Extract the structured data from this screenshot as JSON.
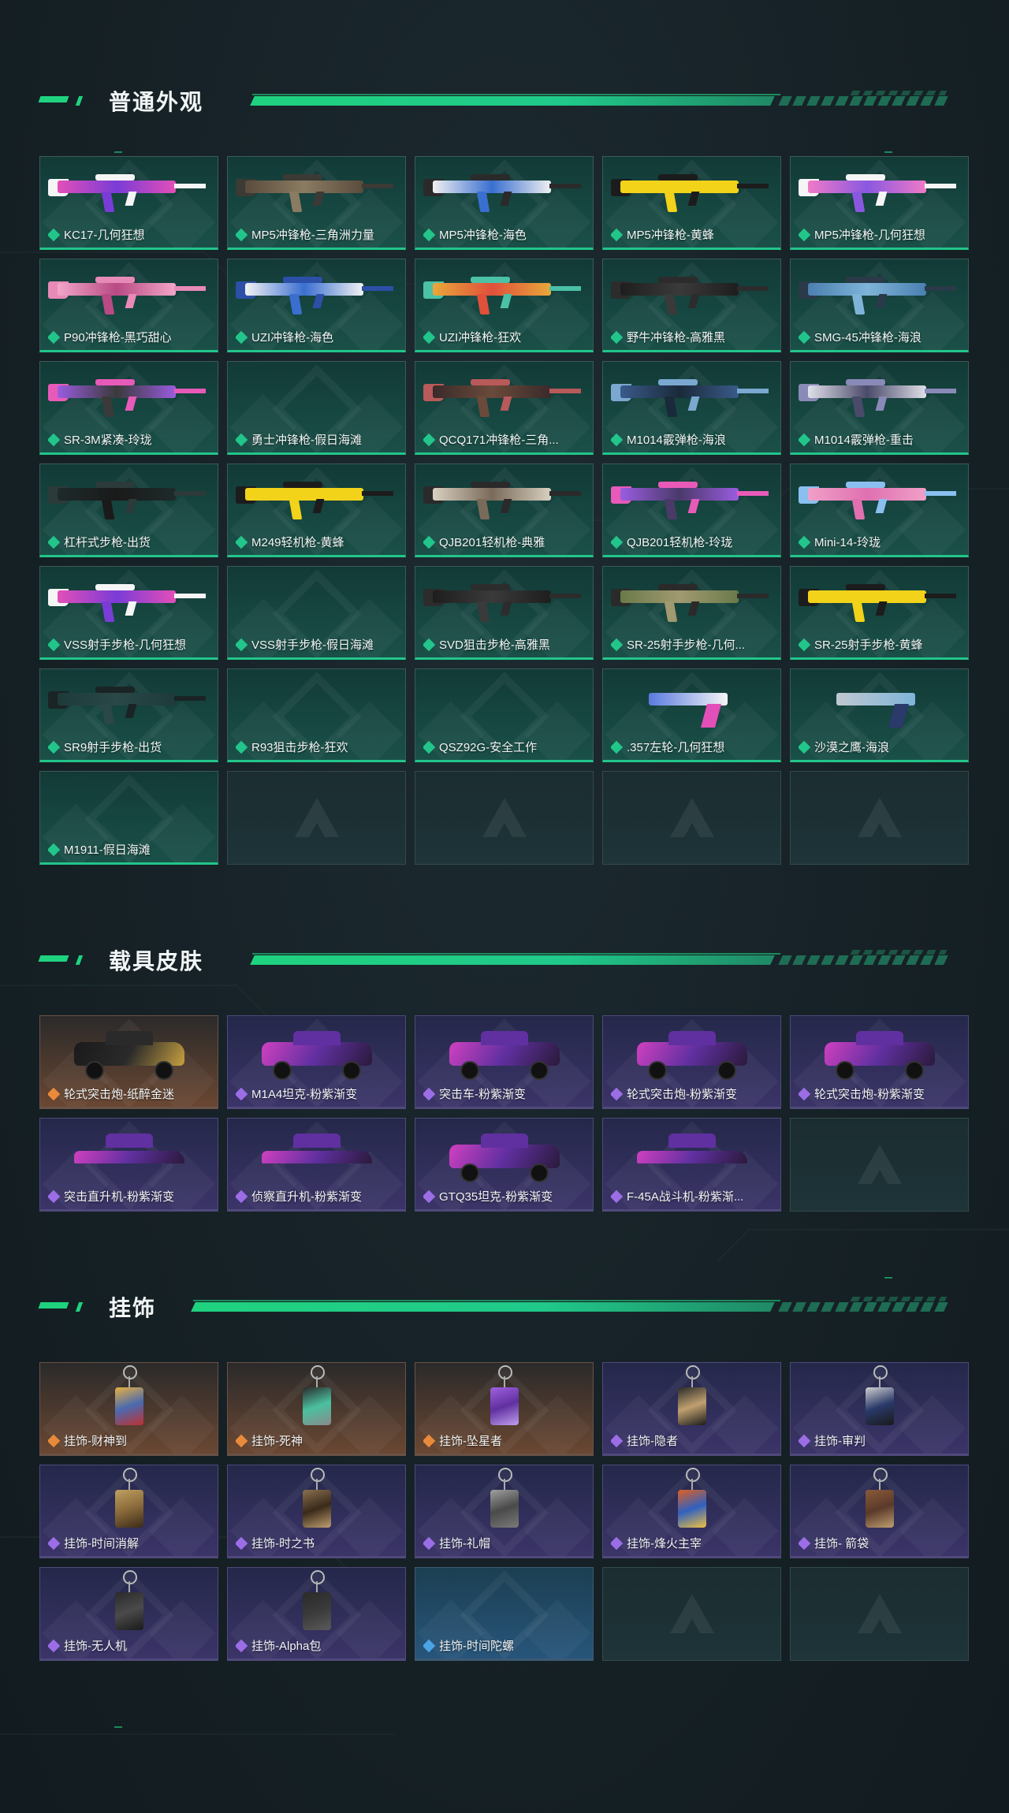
{
  "sections": [
    {
      "id": "weapons",
      "title": "普通外观",
      "items": [
        {
          "name": "KC17-几何狂想",
          "rarity": "green",
          "kind": "gun",
          "colors": [
            "#e34fb8",
            "#f5f5f5",
            "#7a3cd6"
          ]
        },
        {
          "name": "MP5冲锋枪-三角洲力量",
          "rarity": "green",
          "kind": "gun",
          "colors": [
            "#5a4c3c",
            "#3b3a34",
            "#8a7b62"
          ]
        },
        {
          "name": "MP5冲锋枪-海色",
          "rarity": "green",
          "kind": "gun",
          "colors": [
            "#f0f0f0",
            "#2a2a2a",
            "#3a6fd0"
          ]
        },
        {
          "name": "MP5冲锋枪-黄蜂",
          "rarity": "green",
          "kind": "gun",
          "colors": [
            "#f2d31a",
            "#1c1c1c",
            "#f2d31a"
          ]
        },
        {
          "name": "MP5冲锋枪-几何狂想",
          "rarity": "green",
          "kind": "gun",
          "colors": [
            "#f07ac8",
            "#f5f5f5",
            "#8a58e0"
          ]
        },
        {
          "name": "P90冲锋枪-黑巧甜心",
          "rarity": "green",
          "kind": "gun",
          "colors": [
            "#f2a6c8",
            "#e88ab8",
            "#b84a84"
          ]
        },
        {
          "name": "UZI冲锋枪-海色",
          "rarity": "green",
          "kind": "gun",
          "colors": [
            "#f2f2f2",
            "#2c4fa8",
            "#3a6fd0"
          ]
        },
        {
          "name": "UZI冲锋枪-狂欢",
          "rarity": "green",
          "kind": "gun",
          "colors": [
            "#e8a83a",
            "#4bc1a6",
            "#e0503a"
          ]
        },
        {
          "name": "野牛冲锋枪-高雅黑",
          "rarity": "green",
          "kind": "gun",
          "colors": [
            "#1e1e1e",
            "#2c2c2c",
            "#3a3a3a"
          ]
        },
        {
          "name": "SMG-45冲锋枪-海浪",
          "rarity": "green",
          "kind": "gun",
          "colors": [
            "#4a7fb0",
            "#2a3a48",
            "#7fb4d8"
          ]
        },
        {
          "name": "SR-3M紧凑-玲珑",
          "rarity": "green",
          "kind": "gun",
          "colors": [
            "#9a5ce0",
            "#e85ab8",
            "#3a3a3a"
          ]
        },
        {
          "name": "勇士冲锋枪-假日海滩",
          "rarity": "green",
          "kind": "none",
          "colors": []
        },
        {
          "name": "QCQ171冲锋枪-三角...",
          "rarity": "green",
          "kind": "gun",
          "colors": [
            "#3a2a2a",
            "#b85a5a",
            "#6a4a3a"
          ]
        },
        {
          "name": "M1014霰弹枪-海浪",
          "rarity": "green",
          "kind": "gun",
          "colors": [
            "#3a5a8a",
            "#7aa8d0",
            "#1a2a3a"
          ]
        },
        {
          "name": "M1014霰弹枪-重击",
          "rarity": "green",
          "kind": "gun",
          "colors": [
            "#e0e0ea",
            "#8a8ab8",
            "#4a4a6a"
          ]
        },
        {
          "name": "杠杆式步枪-出货",
          "rarity": "green",
          "kind": "gun",
          "colors": [
            "#1e2a2a",
            "#2c3a3a",
            "#1a1a1a"
          ]
        },
        {
          "name": "M249轻机枪-黄蜂",
          "rarity": "green",
          "kind": "gun",
          "colors": [
            "#f2d31a",
            "#1c1c1c",
            "#f2d31a"
          ]
        },
        {
          "name": "QJB201轻机枪-典雅",
          "rarity": "green",
          "kind": "gun",
          "colors": [
            "#d8d0c0",
            "#2a2a2a",
            "#7a6a5a"
          ]
        },
        {
          "name": "QJB201轻机枪-玲珑",
          "rarity": "green",
          "kind": "gun",
          "colors": [
            "#9a5ce0",
            "#e85ab8",
            "#4a3a6a"
          ]
        },
        {
          "name": "Mini-14-玲珑",
          "rarity": "green",
          "kind": "gun",
          "colors": [
            "#f0a0c8",
            "#8ac0f0",
            "#e070b0"
          ]
        },
        {
          "name": "VSS射手步枪-几何狂想",
          "rarity": "green",
          "kind": "gun",
          "colors": [
            "#e34fb8",
            "#f5f5f5",
            "#7a3cd6"
          ]
        },
        {
          "name": "VSS射手步枪-假日海滩",
          "rarity": "green",
          "kind": "none",
          "colors": []
        },
        {
          "name": "SVD狙击步枪-高雅黑",
          "rarity": "green",
          "kind": "gun",
          "colors": [
            "#1e1e1e",
            "#2c2c2c",
            "#3a3a3a"
          ]
        },
        {
          "name": "SR-25射手步枪-几何...",
          "rarity": "green",
          "kind": "gun",
          "colors": [
            "#6a7a4a",
            "#2a2a2a",
            "#a09a70"
          ]
        },
        {
          "name": "SR-25射手步枪-黄蜂",
          "rarity": "green",
          "kind": "gun",
          "colors": [
            "#f2d31a",
            "#1c1c1c",
            "#f2d31a"
          ]
        },
        {
          "name": "SR9射手步枪-出货",
          "rarity": "green",
          "kind": "gun",
          "colors": [
            "#1e3a3a",
            "#1a2424",
            "#2a4848"
          ]
        },
        {
          "name": "R93狙击步枪-狂欢",
          "rarity": "green",
          "kind": "none",
          "colors": []
        },
        {
          "name": "QSZ92G-安全工作",
          "rarity": "green",
          "kind": "none",
          "colors": []
        },
        {
          "name": ".357左轮-几何狂想",
          "rarity": "green",
          "kind": "pistol",
          "colors": [
            "#5a7ae0",
            "#e34fb8",
            "#f5f5f5"
          ]
        },
        {
          "name": "沙漠之鹰-海浪",
          "rarity": "green",
          "kind": "pistol",
          "colors": [
            "#c0c8d0",
            "#2a3a6a",
            "#7fb4d8"
          ]
        },
        {
          "name": "M1911-假日海滩",
          "rarity": "green",
          "kind": "none",
          "colors": []
        }
      ],
      "empty_slots": 4
    },
    {
      "id": "vehicles",
      "title": "载具皮肤",
      "items": [
        {
          "name": "轮式突击炮-纸醉金迷",
          "rarity": "orange",
          "kind": "vehicle",
          "colors": [
            "#1a1a1a",
            "#2a2a2a",
            "#c8a040"
          ]
        },
        {
          "name": "M1A4坦克-粉紫渐变",
          "rarity": "purple",
          "kind": "tank",
          "colors": [
            "#d040c0",
            "#6030a0",
            "#2a1a3a"
          ]
        },
        {
          "name": "突击车-粉紫渐变",
          "rarity": "purple",
          "kind": "vehicle",
          "colors": [
            "#d040c0",
            "#6030a0",
            "#2a1a3a"
          ]
        },
        {
          "name": "轮式突击炮-粉紫渐变",
          "rarity": "purple",
          "kind": "vehicle",
          "colors": [
            "#d040c0",
            "#6030a0",
            "#2a1a3a"
          ]
        },
        {
          "name": "轮式突击炮-粉紫渐变",
          "rarity": "purple",
          "kind": "vehicle",
          "colors": [
            "#d040c0",
            "#6030a0",
            "#2a1a3a"
          ]
        },
        {
          "name": "突击直升机-粉紫渐变",
          "rarity": "purple",
          "kind": "heli",
          "colors": [
            "#d040c0",
            "#6030a0",
            "#2a1a3a"
          ]
        },
        {
          "name": "侦察直升机-粉紫渐变",
          "rarity": "purple",
          "kind": "heli",
          "colors": [
            "#d040c0",
            "#6030a0",
            "#2a1a3a"
          ]
        },
        {
          "name": "GTQ35坦克-粉紫渐变",
          "rarity": "purple",
          "kind": "tank",
          "colors": [
            "#d040c0",
            "#6030a0",
            "#2a1a3a"
          ]
        },
        {
          "name": "F-45A战斗机-粉紫渐...",
          "rarity": "purple",
          "kind": "jet",
          "colors": [
            "#d040c0",
            "#6030a0",
            "#2a1a3a"
          ]
        }
      ],
      "empty_slots": 1
    },
    {
      "id": "charms",
      "title": "挂饰",
      "items": [
        {
          "name": "挂饰-财神到",
          "rarity": "orange",
          "kind": "charm",
          "colors": [
            "#e8b040",
            "#4a6ab0",
            "#c03030"
          ]
        },
        {
          "name": "挂饰-死神",
          "rarity": "orange",
          "kind": "charm",
          "colors": [
            "#2a2a2a",
            "#4ac0a0",
            "#8a8a8a"
          ]
        },
        {
          "name": "挂饰-坠星者",
          "rarity": "orange",
          "kind": "charm",
          "colors": [
            "#a060e0",
            "#6030a0",
            "#c0a0f0"
          ]
        },
        {
          "name": "挂饰-隐者",
          "rarity": "purple",
          "kind": "charm",
          "colors": [
            "#2a2a2a",
            "#c0a070",
            "#1a1a1a"
          ]
        },
        {
          "name": "挂饰-审判",
          "rarity": "purple",
          "kind": "charm",
          "colors": [
            "#d0d0d0",
            "#2a3a6a",
            "#1a1a1a"
          ]
        },
        {
          "name": "挂饰-时间消解",
          "rarity": "purple",
          "kind": "charm",
          "colors": [
            "#c0a060",
            "#8a6a3a",
            "#3a2a1a"
          ]
        },
        {
          "name": "挂饰-时之书",
          "rarity": "purple",
          "kind": "charm",
          "colors": [
            "#8a7050",
            "#3a2a1a",
            "#c0a070"
          ]
        },
        {
          "name": "挂饰-礼帽",
          "rarity": "purple",
          "kind": "charm",
          "colors": [
            "#a0a0a0",
            "#4a4a4a",
            "#7a7a7a"
          ]
        },
        {
          "name": "挂饰-烽火主宰",
          "rarity": "purple",
          "kind": "charm",
          "colors": [
            "#e06020",
            "#3060c0",
            "#f0c040"
          ]
        },
        {
          "name": "挂饰- 箭袋",
          "rarity": "purple",
          "kind": "charm",
          "colors": [
            "#8a5a3a",
            "#5a3a2a",
            "#c0a070"
          ]
        },
        {
          "name": "挂饰-无人机",
          "rarity": "purple",
          "kind": "charm",
          "colors": [
            "#2a2a2a",
            "#4a4a4a",
            "#1a1a1a"
          ]
        },
        {
          "name": "挂饰-Alpha包",
          "rarity": "purple",
          "kind": "charm",
          "colors": [
            "#2a2a2a",
            "#3a3a3a",
            "#5a5a5a"
          ]
        },
        {
          "name": "挂饰-时间陀螺",
          "rarity": "blue",
          "kind": "none",
          "colors": []
        }
      ],
      "empty_slots": 2
    }
  ],
  "rarity_colors": {
    "green": "#22c58a",
    "orange": "#e98a3b",
    "purple": "#9c6ee6",
    "blue": "#4aa4e6"
  },
  "accent": "#1fd27f"
}
